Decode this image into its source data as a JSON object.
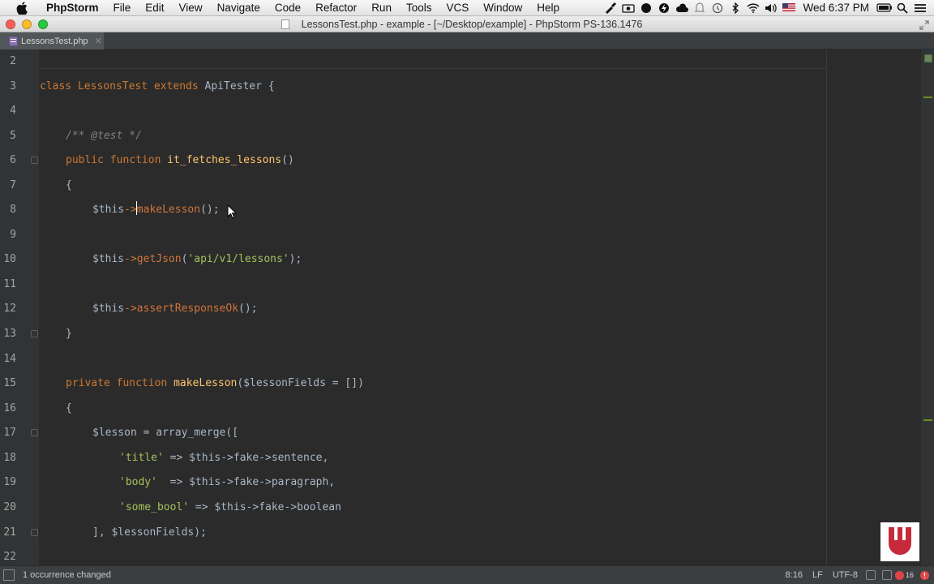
{
  "menubar": {
    "app_name": "PhpStorm",
    "items": [
      "File",
      "Edit",
      "View",
      "Navigate",
      "Code",
      "Refactor",
      "Run",
      "Tools",
      "VCS",
      "Window",
      "Help"
    ],
    "clock": "Wed 6:37 PM"
  },
  "window": {
    "title": "LessonsTest.php - example - [~/Desktop/example] - PhpStorm PS-136.1476"
  },
  "tabs": [
    {
      "label": "LessonsTest.php",
      "active": true
    }
  ],
  "editor": {
    "lines": [
      {
        "num": "2"
      },
      {
        "num": "3"
      },
      {
        "num": "4"
      },
      {
        "num": "5"
      },
      {
        "num": "6"
      },
      {
        "num": "7"
      },
      {
        "num": "8"
      },
      {
        "num": "9"
      },
      {
        "num": "10"
      },
      {
        "num": "11"
      },
      {
        "num": "12"
      },
      {
        "num": "13"
      },
      {
        "num": "14"
      },
      {
        "num": "15"
      },
      {
        "num": "16"
      },
      {
        "num": "17"
      },
      {
        "num": "18"
      },
      {
        "num": "19"
      },
      {
        "num": "20"
      },
      {
        "num": "21"
      },
      {
        "num": "22"
      }
    ],
    "tokens": {
      "l3_class": "class",
      "l3_name": "LessonsTest",
      "l3_extends": "extends",
      "l3_parent": "ApiTester",
      "l3_brace": "{",
      "l5_comment": "/** @test */",
      "l6_public": "public",
      "l6_function": "function",
      "l6_name": "it_fetches_lessons",
      "l6_parens": "()",
      "l7_brace": "{",
      "l8_this": "$this",
      "l8_arrow": "->",
      "l8_method_a": "",
      "l8_method_b": "makeLesson",
      "l8_rest": "();",
      "l10_this": "$this",
      "l10_arrow": "->",
      "l10_method": "getJson",
      "l10_open": "(",
      "l10_str": "'api/v1/lessons'",
      "l10_close": ");",
      "l12_this": "$this",
      "l12_arrow": "->",
      "l12_method": "assertResponseOk",
      "l12_rest": "();",
      "l13_brace": "}",
      "l15_private": "private",
      "l15_function": "function",
      "l15_name": "makeLesson",
      "l15_sig": "($lessonFields = [])",
      "l16_brace": "{",
      "l17_var": "$lesson",
      "l17_rest": " = array_merge([",
      "l18_key": "'title'",
      "l18_arrow": " => ",
      "l18_val": "$this->fake->sentence,",
      "l19_key": "'body'",
      "l19_arrow": "  => ",
      "l19_val": "$this->fake->paragraph,",
      "l20_key": "'some_bool'",
      "l20_arrow": " => ",
      "l20_val": "$this->fake->boolean",
      "l21_text": "], $lessonFields);"
    }
  },
  "statusbar": {
    "message": "1 occurrence changed",
    "position": "8:16",
    "line_sep": "LF",
    "encoding": "UTF-8",
    "error_count": "16"
  },
  "colors": {
    "keyword": "#cc7832",
    "function_name": "#ffc66d",
    "string": "#a5c25c",
    "comment": "#808080",
    "text": "#a9b7c6",
    "background": "#2b2b2b"
  }
}
